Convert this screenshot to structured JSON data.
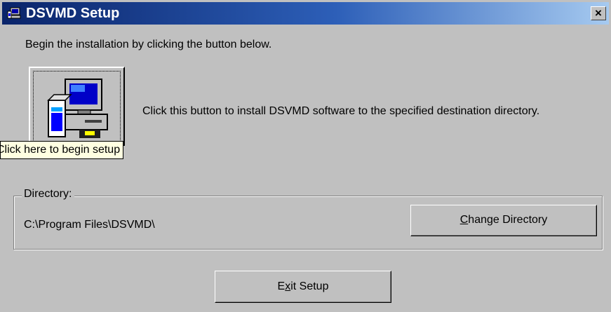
{
  "window": {
    "title": "DSVMD Setup",
    "close_label": "×"
  },
  "main": {
    "instruction": "Begin the installation by clicking the button below.",
    "setup_description": "Click this button to install DSVMD software to the specified destination directory.",
    "tooltip": "Click here to begin setup"
  },
  "directory": {
    "group_label": "Directory:",
    "path": "C:\\Program Files\\DSVMD\\",
    "change_button": {
      "mnemonic": "C",
      "rest": "hange Directory"
    }
  },
  "exit_button": {
    "pre": "E",
    "mnemonic": "x",
    "post": "it Setup"
  },
  "icons": {
    "app_icon": "setup-computer-icon",
    "setup_button_icon": "computer-install-icon",
    "close_icon": "close-icon"
  }
}
